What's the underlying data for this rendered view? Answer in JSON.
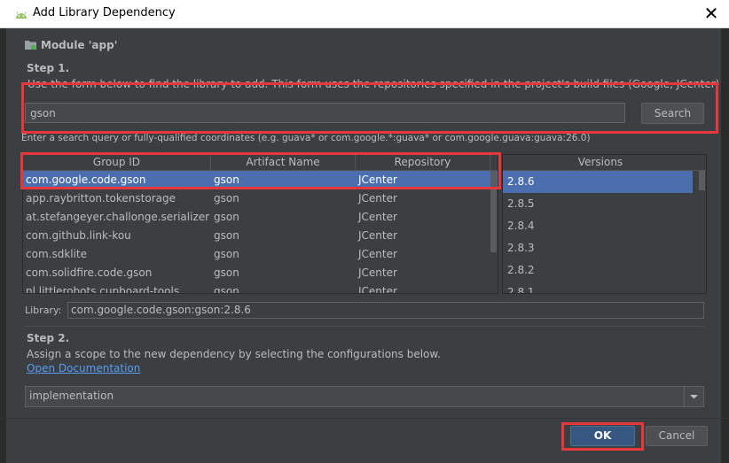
{
  "window": {
    "title": "Add Library Dependency",
    "close_glyph": "✕"
  },
  "module": {
    "label": "Module 'app'"
  },
  "step1": {
    "heading": "Step 1.",
    "description": "Use the form below to find the library to add. This form uses the repositories specified in the project's build files (Google, JCenter)",
    "search_value": "gson",
    "search_button": "Search",
    "hint": "Enter a search query or fully-qualified coordinates (e.g. guava* or com.google.*:guava* or com.google.guava:guava:26.0)"
  },
  "results": {
    "columns": [
      "Group ID",
      "Artifact Name",
      "Repository"
    ],
    "rows": [
      [
        "com.google.code.gson",
        "gson",
        "JCenter"
      ],
      [
        "app.raybritton.tokenstorage",
        "gson",
        "JCenter"
      ],
      [
        "at.stefangeyer.challonge.serializer",
        "gson",
        "JCenter"
      ],
      [
        "com.github.link-kou",
        "gson",
        "JCenter"
      ],
      [
        "com.sdklite",
        "gson",
        "JCenter"
      ],
      [
        "com.solidfire.code.gson",
        "gson",
        "JCenter"
      ],
      [
        "nl.littlerobots.cupboard-tools",
        "gson",
        "JCenter"
      ]
    ],
    "selected_index": 0
  },
  "versions": {
    "header": "Versions",
    "items": [
      "2.8.6",
      "2.8.5",
      "2.8.4",
      "2.8.3",
      "2.8.2",
      "2.8.1"
    ],
    "selected_index": 0
  },
  "library": {
    "label": "Library:",
    "value": "com.google.code.gson:gson:2.8.6"
  },
  "step2": {
    "heading": "Step 2.",
    "description": "Assign a scope to the new dependency by selecting the configurations below.",
    "doc_link": "Open Documentation",
    "configuration": "implementation"
  },
  "buttons": {
    "ok": "OK",
    "cancel": "Cancel"
  },
  "colors": {
    "background": "#3c3f41",
    "selection": "#4b6eaf",
    "link": "#589df6",
    "highlight": "#e8373b",
    "ok_button": "#365880"
  }
}
